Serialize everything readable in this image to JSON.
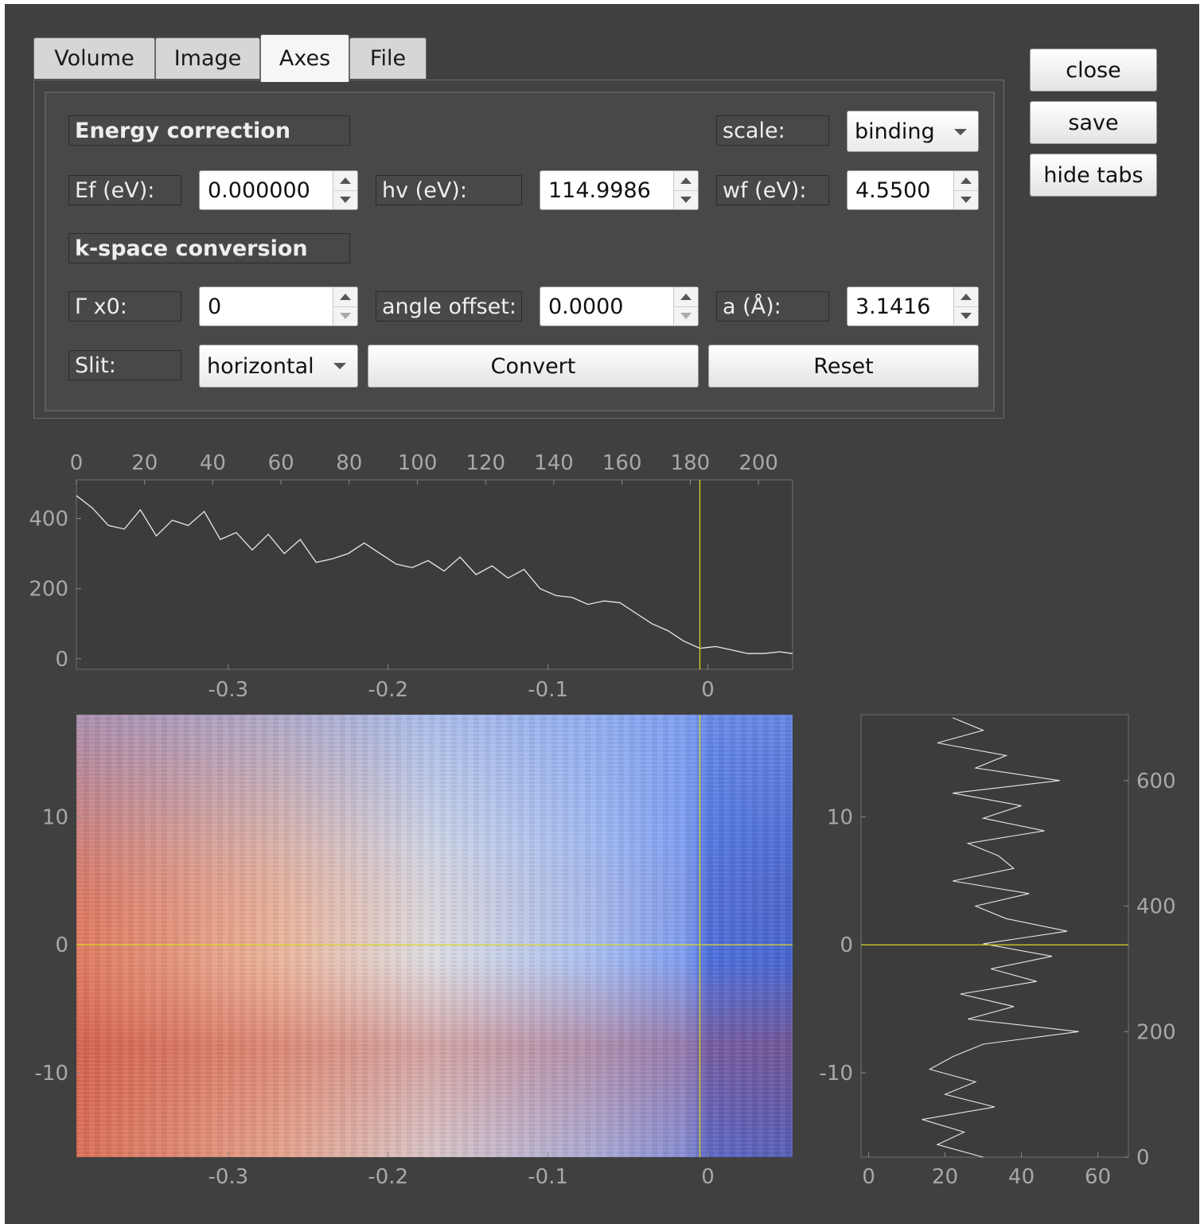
{
  "tabs": [
    "Volume",
    "Image",
    "Axes",
    "File"
  ],
  "active_tab": "Axes",
  "side_buttons": {
    "close": "close",
    "save": "save",
    "hide_tabs": "hide tabs"
  },
  "energy": {
    "section": "Energy correction",
    "scale_label": "scale:",
    "scale_value": "binding",
    "ef_label": "Ef (eV):",
    "ef_value": "0.000000",
    "hv_label": "hv (eV):",
    "hv_value": "114.9986",
    "wf_label": "wf (eV):",
    "wf_value": "4.5500"
  },
  "kspace": {
    "section": "k-space conversion",
    "gx0_label": "Γ x0:",
    "gx0_value": "0",
    "angle_label": "angle offset:",
    "angle_value": "0.0000",
    "a_label": "a (Å):",
    "a_value": "3.1416",
    "slit_label": "Slit:",
    "slit_value": "horizontal",
    "convert_label": "Convert",
    "reset_label": "Reset"
  },
  "colors": {
    "window": "#404040",
    "plot_bg": "#3c3c3c",
    "tick": "#a8a8a8",
    "cursor": "#d8d820",
    "trace": "#e8e8e8"
  },
  "plots": {
    "top_profile": {
      "top_axis_ticks": [
        "0",
        "20",
        "40",
        "60",
        "80",
        "100",
        "120",
        "140",
        "160",
        "180",
        "200"
      ],
      "left_ticks": [
        "400",
        "200",
        "0"
      ],
      "bottom_ticks": [
        "-0.3",
        "-0.2",
        "-0.1",
        "0"
      ],
      "cursor_x": -0.005
    },
    "image": {
      "x_ticks": [
        "-0.3",
        "-0.2",
        "-0.1",
        "0"
      ],
      "y_ticks": [
        "10",
        "0",
        "-10"
      ],
      "x_range": [
        -0.395,
        0.053
      ],
      "y_range": [
        -16.6,
        18
      ],
      "cursor_x": -0.005,
      "cursor_y": 0,
      "colormap": "coolwarm"
    },
    "side_profile": {
      "left_ticks": [
        "10",
        "0",
        "-10"
      ],
      "right_ticks": [
        "600",
        "400",
        "200",
        "0"
      ],
      "bottom_ticks": [
        "0",
        "20",
        "40",
        "60"
      ],
      "cursor_y": 0
    }
  },
  "chart_data": [
    {
      "type": "line",
      "xlabel": "",
      "ylabel": "",
      "xlim": [
        -0.395,
        0.053
      ],
      "ylim": [
        -30,
        510
      ],
      "x": [
        -0.395,
        -0.385,
        -0.375,
        -0.365,
        -0.355,
        -0.345,
        -0.335,
        -0.325,
        -0.315,
        -0.305,
        -0.295,
        -0.285,
        -0.275,
        -0.265,
        -0.255,
        -0.245,
        -0.235,
        -0.225,
        -0.215,
        -0.205,
        -0.195,
        -0.185,
        -0.175,
        -0.165,
        -0.155,
        -0.145,
        -0.135,
        -0.125,
        -0.115,
        -0.105,
        -0.095,
        -0.085,
        -0.075,
        -0.065,
        -0.055,
        -0.045,
        -0.035,
        -0.025,
        -0.015,
        -0.005,
        0.005,
        0.015,
        0.025,
        0.035,
        0.045,
        0.053
      ],
      "y": [
        465,
        430,
        380,
        370,
        425,
        350,
        395,
        380,
        420,
        340,
        360,
        310,
        355,
        300,
        340,
        275,
        285,
        300,
        330,
        300,
        270,
        260,
        280,
        250,
        290,
        240,
        265,
        230,
        255,
        200,
        180,
        175,
        155,
        165,
        160,
        130,
        100,
        80,
        50,
        30,
        35,
        25,
        15,
        15,
        20,
        15
      ]
    },
    {
      "type": "line",
      "xlabel": "",
      "ylabel": "",
      "xlim": [
        -2,
        68
      ],
      "ylim": [
        0,
        705
      ],
      "note_axis": "vertical profile: x = intensity, y = row index",
      "y": [
        0,
        20,
        40,
        60,
        80,
        100,
        120,
        140,
        160,
        180,
        200,
        220,
        240,
        260,
        280,
        300,
        320,
        340,
        360,
        380,
        400,
        420,
        440,
        460,
        480,
        500,
        520,
        540,
        560,
        580,
        600,
        620,
        640,
        660,
        680,
        700
      ],
      "x": [
        30,
        18,
        25,
        14,
        33,
        20,
        28,
        16,
        22,
        30,
        55,
        26,
        38,
        24,
        44,
        32,
        48,
        30,
        52,
        36,
        28,
        42,
        22,
        38,
        34,
        26,
        46,
        30,
        40,
        22,
        50,
        28,
        36,
        18,
        30,
        22
      ]
    }
  ]
}
